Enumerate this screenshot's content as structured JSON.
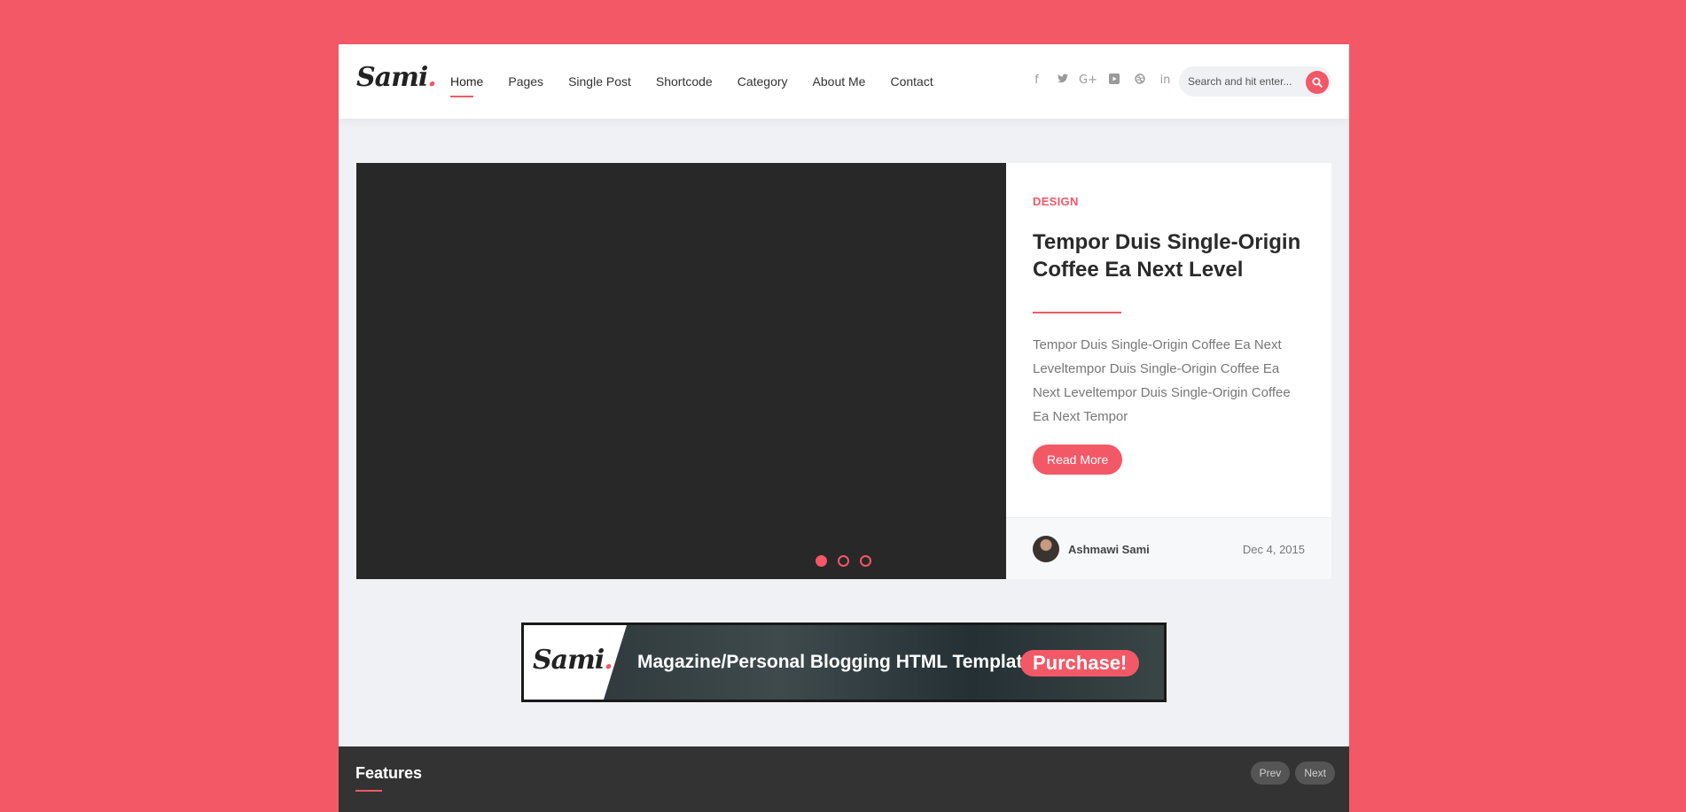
{
  "brand": {
    "logo_text": "Sami",
    "logo_dot": ".",
    "accent": "#f25866"
  },
  "nav": {
    "items": [
      {
        "label": "Home",
        "active": true
      },
      {
        "label": "Pages"
      },
      {
        "label": "Single Post"
      },
      {
        "label": "Shortcode"
      },
      {
        "label": "Category"
      },
      {
        "label": "About Me"
      },
      {
        "label": "Contact"
      }
    ]
  },
  "socials": [
    {
      "icon": "facebook-icon",
      "glyph": "f"
    },
    {
      "icon": "twitter-icon",
      "glyph": "🐦"
    },
    {
      "icon": "google-plus-icon",
      "glyph": "G+"
    },
    {
      "icon": "youtube-icon",
      "glyph": "▶"
    },
    {
      "icon": "dribbble-icon",
      "glyph": "◎"
    },
    {
      "icon": "linkedin-icon",
      "glyph": "in"
    }
  ],
  "search": {
    "placeholder": "Search and hit enter..."
  },
  "slider": {
    "active_slide": 1,
    "slide_count": 3,
    "post": {
      "category": "DESIGN",
      "title": "Tempor Duis Single-Origin Coffee Ea Next Level",
      "excerpt": "Tempor Duis Single-Origin Coffee Ea Next Leveltempor Duis Single-Origin Coffee Ea Next Leveltempor Duis Single-Origin Coffee Ea Next Tempor",
      "read_more_label": "Read More",
      "author": "Ashmawi Sami",
      "date": "Dec 4, 2015"
    }
  },
  "banner": {
    "logo_text": "Sami",
    "logo_dot": ".",
    "text": "Magazine/Personal Blogging HTML Template",
    "cta": "Purchase!"
  },
  "features": {
    "title": "Features",
    "prev_label": "Prev",
    "next_label": "Next"
  }
}
